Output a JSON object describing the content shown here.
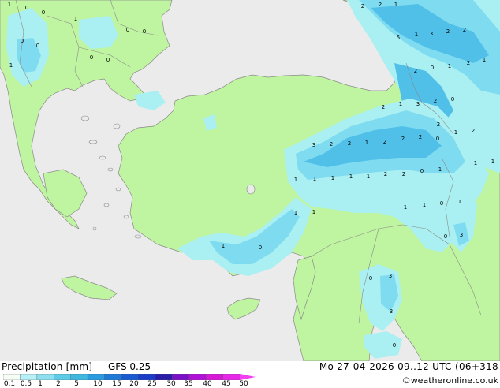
{
  "footer": {
    "title": "Precipitation [mm]",
    "model": "GFS 0.25",
    "datetime": "Mo 27-04-2026 09..12 UTC (06+318",
    "credit": "©weatheronline.co.uk"
  },
  "legend": {
    "labels": [
      "0.1",
      "0.5",
      "1",
      "2",
      "5",
      "10",
      "15",
      "20",
      "25",
      "30",
      "35",
      "40",
      "45",
      "50"
    ],
    "colors": [
      "#f5fff5",
      "#b8f0f8",
      "#8ee0f0",
      "#5ccbe8",
      "#3fb8e0",
      "#2a9be0",
      "#1e7ad8",
      "#1a5ad0",
      "#1a3cc8",
      "#2a1ca8",
      "#7a10c8",
      "#b010d8",
      "#d818d8",
      "#e828e8",
      "#f040f0"
    ]
  },
  "colors": {
    "sea": "#ebebeb",
    "land_no_rain": "#bff5a0",
    "rain_light": "#aaf0f2",
    "rain_moderate": "#7fdcf0",
    "rain_heavy": "#50c0e8",
    "border": "#8a8a8a"
  },
  "map_values": [
    "1",
    "0",
    "0",
    "1",
    "0",
    "0",
    "0",
    "0",
    "0",
    "0",
    "1",
    "2",
    "2",
    "1",
    "5",
    "1",
    "3",
    "2",
    "2",
    "2",
    "0",
    "1",
    "2",
    "1",
    "2",
    "1",
    "3",
    "2",
    "0",
    "2",
    "1",
    "2",
    "3",
    "2",
    "2",
    "1",
    "2",
    "2",
    "2",
    "0",
    "1",
    "1",
    "1",
    "1",
    "1",
    "1",
    "1",
    "2",
    "2",
    "0",
    "1",
    "1",
    "1",
    "0",
    "1",
    "1",
    "1",
    "3",
    "0",
    "3",
    "3",
    "0",
    "0",
    "1",
    "0"
  ]
}
